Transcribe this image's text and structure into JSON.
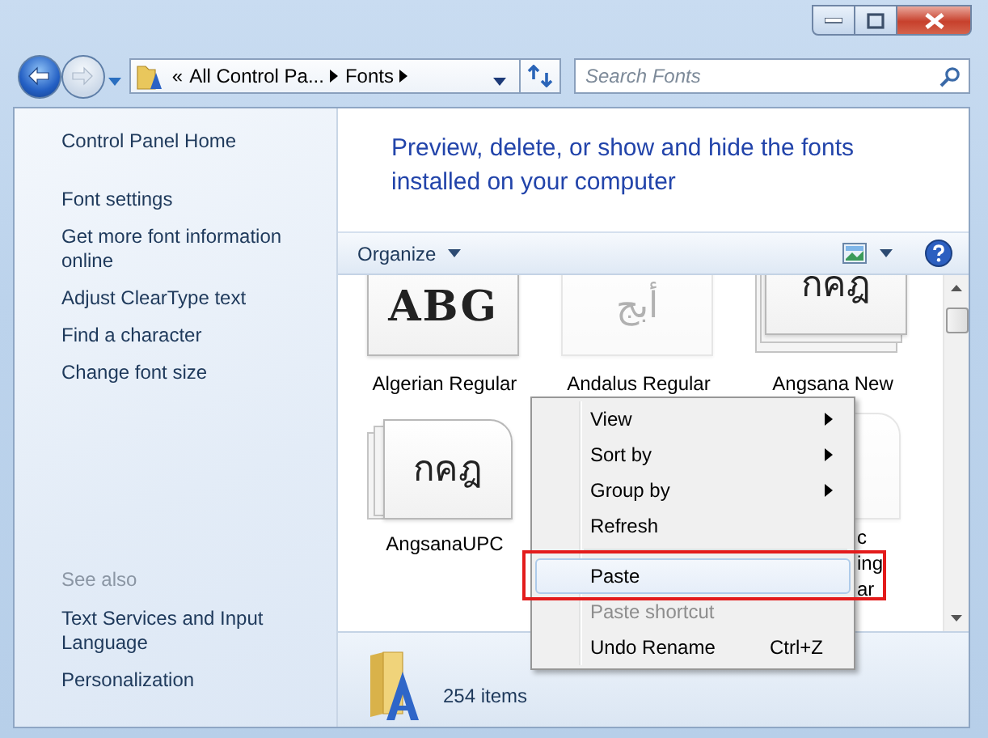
{
  "nav": {
    "back_enabled": true,
    "forward_enabled": false
  },
  "address": {
    "overflow": "«",
    "crumbs": [
      "All Control Pa...",
      "Fonts"
    ]
  },
  "search": {
    "placeholder": "Search Fonts"
  },
  "sidebar": {
    "links": [
      "Control Panel Home",
      "Font settings",
      "Get more font information online",
      "Adjust ClearType text",
      "Find a character",
      "Change font size"
    ],
    "see_also": {
      "heading": "See also",
      "links": [
        "Text Services and Input Language",
        "Personalization"
      ]
    }
  },
  "header": {
    "title": "Preview, delete, or show and hide the fonts installed on your computer"
  },
  "toolbar": {
    "organize": "Organize"
  },
  "fonts": [
    {
      "kind": "tile",
      "preview": "ABG",
      "preview_bold": true,
      "stacked": false,
      "hidden": false,
      "label_lines": [
        "Algerian Regular"
      ]
    },
    {
      "kind": "tile",
      "preview": "أبج",
      "preview_bold": false,
      "stacked": false,
      "hidden": true,
      "label_lines": [
        "Andalus Regular"
      ]
    },
    {
      "kind": "tile",
      "preview": "กคฎ",
      "preview_bold": false,
      "stacked": true,
      "hidden": false,
      "label_lines": [
        "Angsana New"
      ]
    },
    {
      "kind": "page",
      "preview": "กคฎ",
      "preview_bold": false,
      "stacked": true,
      "hidden": false,
      "label_lines": [
        "AngsanaUPC"
      ]
    },
    {
      "kind": "page",
      "stacked": false,
      "hidden": true,
      "label_lines": [
        "c",
        "ing",
        "ar"
      ]
    }
  ],
  "status": {
    "count": "254 items"
  },
  "context_menu": {
    "items": [
      {
        "kind": "item",
        "label": "View",
        "submenu": true,
        "disabled": false,
        "selected": false,
        "annotated": false
      },
      {
        "kind": "item",
        "label": "Sort by",
        "submenu": true,
        "disabled": false,
        "selected": false,
        "annotated": false
      },
      {
        "kind": "item",
        "label": "Group by",
        "submenu": true,
        "disabled": false,
        "selected": false,
        "annotated": false
      },
      {
        "kind": "item",
        "label": "Refresh",
        "submenu": false,
        "disabled": false,
        "selected": false,
        "annotated": false
      },
      {
        "kind": "separator"
      },
      {
        "kind": "item",
        "label": "Paste",
        "submenu": false,
        "disabled": false,
        "selected": true,
        "annotated": true
      },
      {
        "kind": "item",
        "label": "Paste shortcut",
        "submenu": false,
        "disabled": true,
        "selected": false,
        "annotated": false
      },
      {
        "kind": "item",
        "label": "Undo Rename",
        "shortcut": "Ctrl+Z",
        "submenu": false,
        "disabled": false,
        "selected": false,
        "annotated": false
      }
    ]
  }
}
